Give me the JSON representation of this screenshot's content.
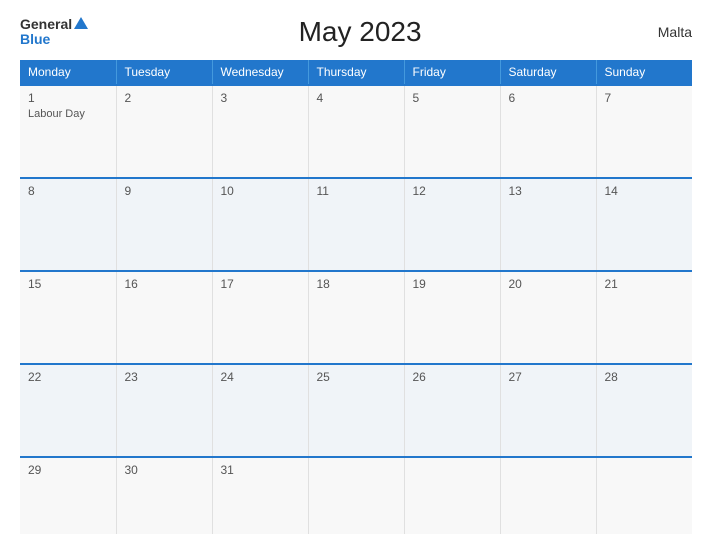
{
  "logo": {
    "general": "General",
    "blue": "Blue"
  },
  "header": {
    "title": "May 2023",
    "country": "Malta"
  },
  "days_of_week": [
    "Monday",
    "Tuesday",
    "Wednesday",
    "Thursday",
    "Friday",
    "Saturday",
    "Sunday"
  ],
  "weeks": [
    [
      {
        "day": "1",
        "holiday": "Labour Day"
      },
      {
        "day": "2",
        "holiday": ""
      },
      {
        "day": "3",
        "holiday": ""
      },
      {
        "day": "4",
        "holiday": ""
      },
      {
        "day": "5",
        "holiday": ""
      },
      {
        "day": "6",
        "holiday": ""
      },
      {
        "day": "7",
        "holiday": ""
      }
    ],
    [
      {
        "day": "8",
        "holiday": ""
      },
      {
        "day": "9",
        "holiday": ""
      },
      {
        "day": "10",
        "holiday": ""
      },
      {
        "day": "11",
        "holiday": ""
      },
      {
        "day": "12",
        "holiday": ""
      },
      {
        "day": "13",
        "holiday": ""
      },
      {
        "day": "14",
        "holiday": ""
      }
    ],
    [
      {
        "day": "15",
        "holiday": ""
      },
      {
        "day": "16",
        "holiday": ""
      },
      {
        "day": "17",
        "holiday": ""
      },
      {
        "day": "18",
        "holiday": ""
      },
      {
        "day": "19",
        "holiday": ""
      },
      {
        "day": "20",
        "holiday": ""
      },
      {
        "day": "21",
        "holiday": ""
      }
    ],
    [
      {
        "day": "22",
        "holiday": ""
      },
      {
        "day": "23",
        "holiday": ""
      },
      {
        "day": "24",
        "holiday": ""
      },
      {
        "day": "25",
        "holiday": ""
      },
      {
        "day": "26",
        "holiday": ""
      },
      {
        "day": "27",
        "holiday": ""
      },
      {
        "day": "28",
        "holiday": ""
      }
    ],
    [
      {
        "day": "29",
        "holiday": ""
      },
      {
        "day": "30",
        "holiday": ""
      },
      {
        "day": "31",
        "holiday": ""
      },
      {
        "day": "",
        "holiday": ""
      },
      {
        "day": "",
        "holiday": ""
      },
      {
        "day": "",
        "holiday": ""
      },
      {
        "day": "",
        "holiday": ""
      }
    ]
  ]
}
